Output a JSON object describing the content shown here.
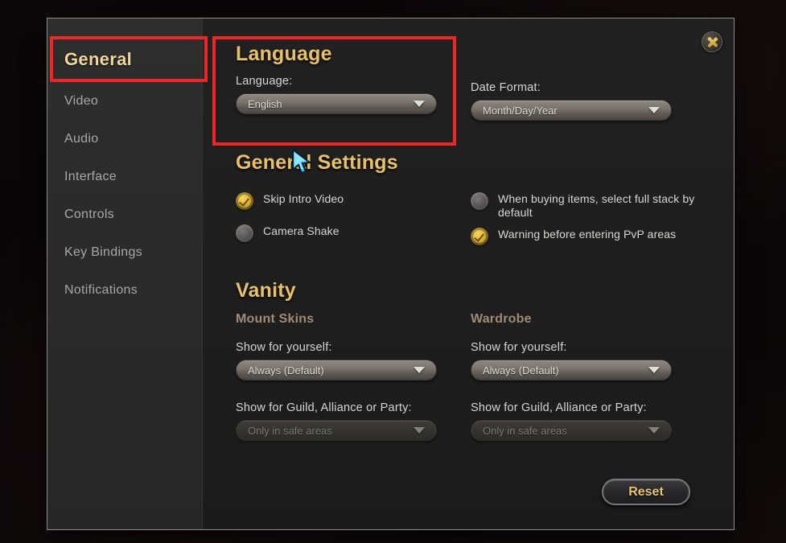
{
  "window": {
    "close_icon": "close-x-icon"
  },
  "sidebar": {
    "items": [
      {
        "label": "General",
        "active": true
      },
      {
        "label": "Video",
        "active": false
      },
      {
        "label": "Audio",
        "active": false
      },
      {
        "label": "Interface",
        "active": false
      },
      {
        "label": "Controls",
        "active": false
      },
      {
        "label": "Key Bindings",
        "active": false
      },
      {
        "label": "Notifications",
        "active": false
      }
    ]
  },
  "language_section": {
    "heading": "Language",
    "language_label": "Language:",
    "language_value": "English",
    "date_format_label": "Date Format:",
    "date_format_value": "Month/Day/Year"
  },
  "general_settings": {
    "heading": "General Settings",
    "left_options": [
      {
        "label": "Skip Intro Video",
        "checked": true
      },
      {
        "label": "Camera Shake",
        "checked": false
      }
    ],
    "right_options": [
      {
        "label": "When buying items, select full stack by default",
        "checked": false
      },
      {
        "label": "Warning before entering PvP areas",
        "checked": true
      }
    ]
  },
  "vanity": {
    "heading": "Vanity",
    "mount_skins": {
      "title": "Mount Skins",
      "self_label": "Show for yourself:",
      "self_value": "Always (Default)",
      "group_label": "Show for Guild, Alliance or Party:",
      "group_value": "Only in safe areas"
    },
    "wardrobe": {
      "title": "Wardrobe",
      "self_label": "Show for yourself:",
      "self_value": "Always (Default)",
      "group_label": "Show for Guild, Alliance or Party:",
      "group_value": "Only in safe areas"
    }
  },
  "footer": {
    "reset_label": "Reset"
  },
  "scrollbar": {
    "up_arrow_icon": "triangle-up-icon",
    "down_arrow_icon": "triangle-down-icon"
  },
  "cursor": {
    "icon": "mouse-pointer-icon"
  },
  "annotations": {
    "highlight_color": "#ef2626",
    "boxes": [
      {
        "name": "general-tab-highlight"
      },
      {
        "name": "language-section-highlight"
      }
    ]
  },
  "colors": {
    "accent_gold": "#e9c06a",
    "panel_bg": "#1f1f1f",
    "sidebar_bg": "#2b2b2b",
    "checked_gold": "#e0b32f"
  }
}
